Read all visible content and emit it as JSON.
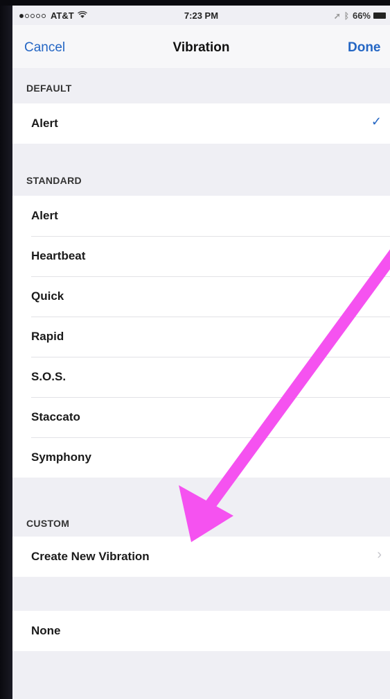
{
  "status_bar": {
    "carrier": "AT&T",
    "time": "7:23 PM",
    "battery_percent": "66%",
    "signal_dots_filled": 1,
    "signal_dots_total": 5
  },
  "nav": {
    "cancel_label": "Cancel",
    "title": "Vibration",
    "done_label": "Done"
  },
  "sections": {
    "default": {
      "header": "DEFAULT",
      "items": [
        {
          "label": "Alert",
          "selected": true
        }
      ]
    },
    "standard": {
      "header": "STANDARD",
      "items": [
        {
          "label": "Alert"
        },
        {
          "label": "Heartbeat"
        },
        {
          "label": "Quick"
        },
        {
          "label": "Rapid"
        },
        {
          "label": "S.O.S."
        },
        {
          "label": "Staccato"
        },
        {
          "label": "Symphony"
        }
      ]
    },
    "custom": {
      "header": "CUSTOM",
      "items": [
        {
          "label": "Create New Vibration"
        }
      ]
    },
    "none": {
      "items": [
        {
          "label": "None"
        }
      ]
    }
  },
  "icons": {
    "check": "checkmark-icon",
    "chevron": "chevron-right-icon",
    "wifi": "wifi-icon",
    "battery": "battery-icon"
  },
  "colors": {
    "accent": "#2466c4",
    "annotation_arrow": "#f552f0",
    "background": "#efeff4"
  }
}
